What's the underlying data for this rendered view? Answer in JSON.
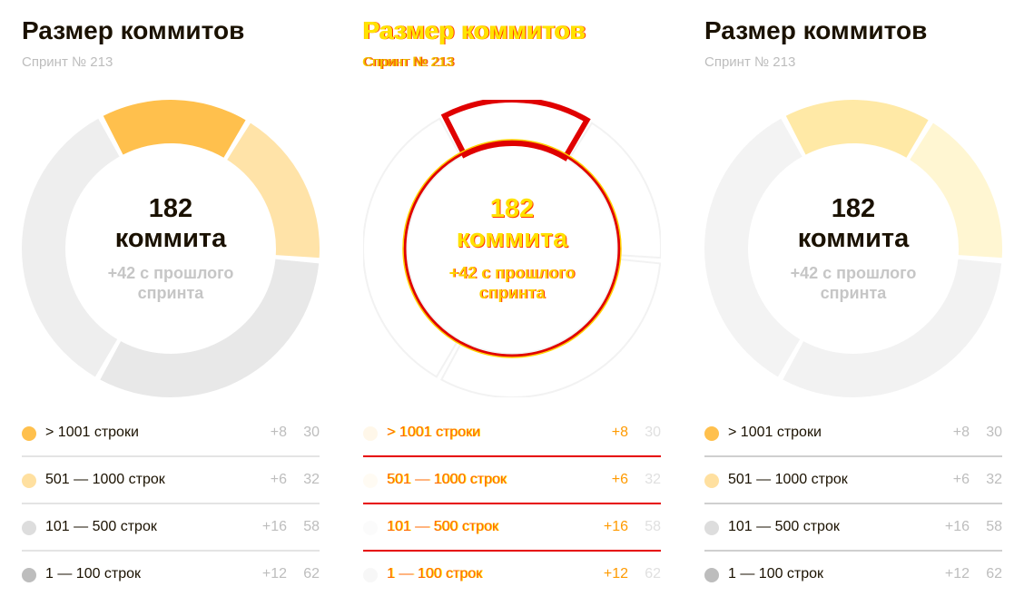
{
  "panels": [
    {
      "title": "Размер коммитов",
      "subtitle": "Спринт № 213",
      "total": "182",
      "unit": "коммита",
      "delta": "+42 с прошлого спринта"
    },
    {
      "title": "Размер коммитов",
      "subtitle": "Спринт № 213",
      "total": "182",
      "unit": "коммита",
      "delta": "+42 с прошлого спринта"
    },
    {
      "title": "Размер коммитов",
      "subtitle": "Спринт № 213",
      "total": "182",
      "unit": "коммита",
      "delta": "+42 с прошлого спринта"
    }
  ],
  "legend": [
    {
      "label": "> 1001 строки",
      "change": "+8",
      "count": "30"
    },
    {
      "label": "501 — 1000 строк",
      "change": "+6",
      "count": "32"
    },
    {
      "label": "101 — 500 строк",
      "change": "+16",
      "count": "58"
    },
    {
      "label": "1 — 100 строк",
      "change": "+12",
      "count": "62"
    }
  ],
  "colors": {
    "seg1": "#ffc04d",
    "seg2": "#ffe3a8",
    "seg3": "#e8e8e8",
    "seg4": "#eeeeee",
    "dot1": "#ffc04d",
    "dot2": "#ffe0a0",
    "dot3": "#dddddd",
    "dot4": "#bdbdbd",
    "seg1_light": "#ffe9a6",
    "seg2_light": "#fff6d2",
    "seg3_light": "#f2f2f2",
    "seg4_light": "#f3f3f3"
  },
  "chart_data": [
    {
      "type": "pie",
      "categories": [
        "> 1001 строки",
        "501 — 1000 строк",
        "101 — 500 строк",
        "1 — 100 строк"
      ],
      "values": [
        30,
        32,
        58,
        62
      ],
      "changes": [
        8,
        6,
        16,
        12
      ]
    },
    {
      "type": "pie",
      "categories": [
        "> 1001 строки",
        "501 — 1000 строк",
        "101 — 500 строк",
        "1 — 100 строк"
      ],
      "values": [
        30,
        32,
        58,
        62
      ],
      "changes": [
        8,
        6,
        16,
        12
      ]
    },
    {
      "type": "pie",
      "categories": [
        "> 1001 строки",
        "501 — 1000 строк",
        "101 — 500 строк",
        "1 — 100 строк"
      ],
      "values": [
        30,
        32,
        58,
        62
      ],
      "changes": [
        8,
        6,
        16,
        12
      ]
    }
  ]
}
